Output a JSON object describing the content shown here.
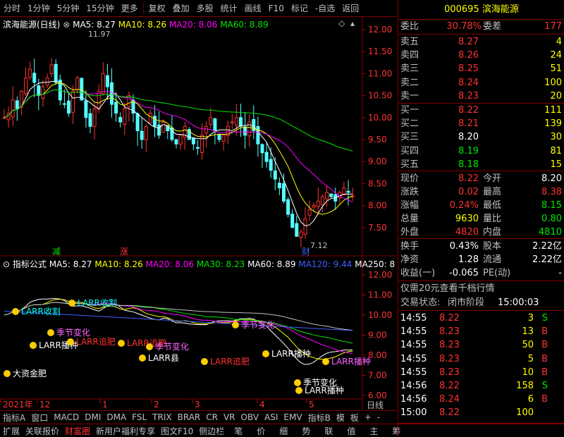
{
  "toolbar": {
    "items": [
      "分时",
      "1分钟",
      "5分钟",
      "15分钟",
      "更多",
      "复权",
      "叠加",
      "多股",
      "统计",
      "画线",
      "F10",
      "标记",
      "-自选",
      "返回"
    ]
  },
  "main_chart": {
    "title": "滨海能源(日线)",
    "ma5": "MA5: 8.27",
    "ma10": "MA10: 8.26",
    "ma20": "MA20: 8.06",
    "ma60": "MA60: 8.89",
    "high_label": "11.97",
    "low_label": "7.12",
    "yticks": [
      "12.00",
      "11.50",
      "11.00",
      "10.50",
      "10.00",
      "9.50",
      "9.00",
      "8.50",
      "8.00",
      "7.50"
    ],
    "markers": [
      "减",
      "涨",
      "财"
    ]
  },
  "indicator": {
    "title": "指标公式",
    "ma5": "MA5: 8.27",
    "ma10": "MA10: 8.26",
    "ma20": "MA20: 8.06",
    "ma30": "MA30: 8.23",
    "ma60": "MA60: 8.89",
    "ma120": "MA120: 9.44",
    "ma250": "MA250: 8",
    "yticks": [
      "12.00",
      "11.00",
      "10.00",
      "9.00",
      "8.00",
      "7.00",
      "6.00"
    ],
    "signals": [
      "LARR收割",
      "LARR收割",
      "季节变化",
      "LARR播种",
      "LARR追肥",
      "LARR追肥",
      "季节变化",
      "LARR播种",
      "大资金肥",
      "LARR追肥",
      "季节变化",
      "LARR播种",
      "季节变化",
      "LARR县",
      "LARR播种"
    ],
    "xaxis": [
      "2021年",
      "12",
      "1",
      "2",
      "3",
      "4",
      "5"
    ],
    "day_label": "日线"
  },
  "bottom_tabs": [
    "指标A",
    "窗口",
    "MACD",
    "DMI",
    "DMA",
    "FSL",
    "TRIX",
    "BRAR",
    "CR",
    "VR",
    "OBV",
    "ASI",
    "EMV",
    "指标B",
    "模",
    "板",
    "+",
    "-"
  ],
  "status_bar": [
    "扩展",
    "关联报价",
    "财富圈",
    "新用户福利专享",
    "图文F10",
    "侧边栏",
    "笔",
    "价",
    "细",
    "势",
    "联",
    "值",
    "主",
    "筹"
  ],
  "quote": {
    "code": "000695",
    "name": "滨海能源",
    "weibi_label": "委比",
    "weibi": "30.78%",
    "weicha_label": "委差",
    "weicha": "177",
    "sells": [
      {
        "label": "卖五",
        "price": "8.27",
        "vol": "4"
      },
      {
        "label": "卖四",
        "price": "8.26",
        "vol": "24"
      },
      {
        "label": "卖三",
        "price": "8.25",
        "vol": "51"
      },
      {
        "label": "卖二",
        "price": "8.24",
        "vol": "100"
      },
      {
        "label": "卖一",
        "price": "8.23",
        "vol": "20"
      }
    ],
    "buys": [
      {
        "label": "买一",
        "price": "8.22",
        "vol": "111"
      },
      {
        "label": "买二",
        "price": "8.21",
        "vol": "139"
      },
      {
        "label": "买三",
        "price": "8.20",
        "vol": "30"
      },
      {
        "label": "买四",
        "price": "8.19",
        "vol": "81"
      },
      {
        "label": "买五",
        "price": "8.18",
        "vol": "15"
      }
    ],
    "stats": [
      {
        "l1": "现价",
        "v1": "8.22",
        "c1": "red",
        "l2": "今开",
        "v2": "8.20",
        "c2": "white"
      },
      {
        "l1": "涨跌",
        "v1": "0.02",
        "c1": "red",
        "l2": "最高",
        "v2": "8.38",
        "c2": "red"
      },
      {
        "l1": "涨幅",
        "v1": "0.24%",
        "c1": "red",
        "l2": "最低",
        "v2": "8.15",
        "c2": "green"
      },
      {
        "l1": "总量",
        "v1": "9630",
        "c1": "yellow",
        "l2": "量比",
        "v2": "0.80",
        "c2": "green"
      },
      {
        "l1": "外盘",
        "v1": "4820",
        "c1": "red",
        "l2": "内盘",
        "v2": "4810",
        "c2": "green"
      }
    ],
    "stats2": [
      {
        "l1": "换手",
        "v1": "0.43%",
        "l2": "股本",
        "v2": "2.22亿"
      },
      {
        "l1": "净资",
        "v1": "1.28",
        "l2": "流通",
        "v2": "2.22亿"
      },
      {
        "l1": "收益(一)",
        "v1": "-0.065",
        "l2": "PE(动)",
        "v2": "-"
      }
    ],
    "promo": "仅需20元查看千档行情",
    "trade_state_label": "交易状态:",
    "trade_state": "闭市阶段",
    "trade_time": "15:00:03",
    "ticks": [
      {
        "t": "14:55",
        "p": "8.22",
        "v": "3",
        "s": "S"
      },
      {
        "t": "14:55",
        "p": "8.23",
        "v": "13",
        "s": "B"
      },
      {
        "t": "14:55",
        "p": "8.23",
        "v": "50",
        "s": "B"
      },
      {
        "t": "14:55",
        "p": "8.23",
        "v": "5",
        "s": "B"
      },
      {
        "t": "14:55",
        "p": "8.23",
        "v": "10",
        "s": "B"
      },
      {
        "t": "14:56",
        "p": "8.22",
        "v": "158",
        "s": "S"
      },
      {
        "t": "14:56",
        "p": "8.24",
        "v": "6",
        "s": "B"
      },
      {
        "t": "15:00",
        "p": "8.22",
        "v": "100",
        "s": ""
      }
    ]
  }
}
